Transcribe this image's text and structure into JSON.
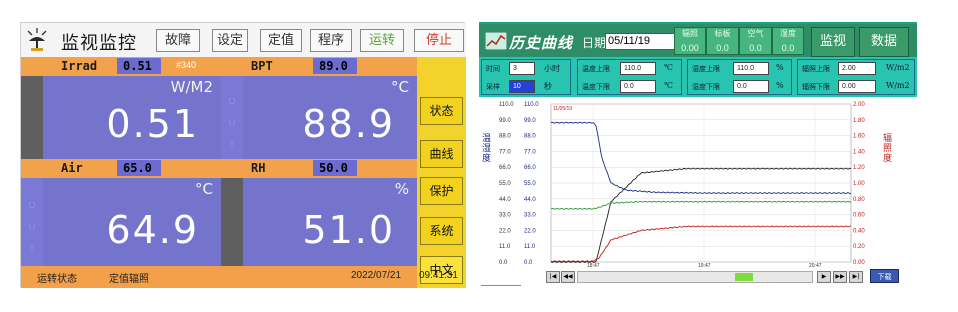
{
  "left_panel": {
    "title": "监视监控",
    "menu": [
      "故障",
      "设定",
      "定值",
      "程序",
      "运转",
      "停止"
    ],
    "sensors": {
      "irrad": {
        "label": "Irrad",
        "setpoint": "0.51",
        "tag": "#340",
        "unit": "W/M2",
        "value": "0.51"
      },
      "bpt": {
        "label": "BPT",
        "setpoint": "89.0",
        "unit": "°C",
        "value": "88.9"
      },
      "air": {
        "label": "Air",
        "setpoint": "65.0",
        "unit": "°C",
        "value": "64.9"
      },
      "rh": {
        "label": "RH",
        "setpoint": "50.0",
        "unit": "%",
        "value": "51.0"
      }
    },
    "out_label": "OUT",
    "side_buttons": [
      "状态",
      "曲线",
      "保护",
      "系统",
      "中文"
    ],
    "status": {
      "label": "运转状态",
      "mode": "定值辐照",
      "date": "2022/07/21",
      "time": "09:41:31"
    }
  },
  "right_panel": {
    "title": "历史曲线",
    "date_label": "日期",
    "date_value": "05/11/19",
    "mini_readouts": [
      {
        "label": "辐照",
        "value": "0.00"
      },
      {
        "label": "标板",
        "value": "0.0"
      },
      {
        "label": "空气",
        "value": "0.0"
      },
      {
        "label": "湿度",
        "value": "0.0"
      }
    ],
    "buttons": {
      "monitor": "监视",
      "data": "数据"
    },
    "params": {
      "time_label": "时间",
      "time_value": "3",
      "time_unit": "小时",
      "sample_label": "采样",
      "sample_value": "10",
      "sample_unit": "秒",
      "temp_upper_label": "温度上限",
      "temp_upper_value": "110.0",
      "temp_lower_label": "温度下限",
      "temp_lower_value": "0.0",
      "temp_unit": "℃",
      "hum_upper_label": "湿度上限",
      "hum_upper_value": "110.0",
      "hum_lower_label": "湿度下限",
      "hum_lower_value": "0.0",
      "hum_unit": "%",
      "rad_upper_label": "辐照上限",
      "rad_upper_value": "2.00",
      "rad_lower_label": "辐照下限",
      "rad_lower_value": "0.00",
      "rad_unit": "W/m2"
    },
    "download_label": "下载",
    "colors": {
      "header": "#2e8c66",
      "params": "#28c4b0",
      "temp": "#1a2a8a",
      "rad": "#c0201a",
      "green": "#2a9a3a"
    }
  },
  "chart_data": {
    "type": "line",
    "ylabel_left": "温湿度",
    "ylabel_right": "辐照度",
    "ylim_left": [
      0.0,
      110.0
    ],
    "ylim_right": [
      0.0,
      2.0
    ],
    "y_ticks_left": [
      "110.0",
      "99.0",
      "88.0",
      "77.0",
      "66.0",
      "55.0",
      "44.0",
      "33.0",
      "22.0",
      "11.0",
      "0.0"
    ],
    "y_ticks_right": [
      "2.00",
      "1.80",
      "1.60",
      "1.40",
      "1.20",
      "1.00",
      "0.80",
      "0.60",
      "0.40",
      "0.20",
      "0.00"
    ],
    "top_label": "11/05/19",
    "x_ticks": [
      "18:47",
      "19:47",
      "20:47"
    ],
    "grid": true,
    "series": [
      {
        "color": "#1a2a8a",
        "axis": "left",
        "x": [
          0,
          0.14,
          0.15,
          0.17,
          0.2,
          0.25,
          0.35,
          0.5,
          0.7,
          1.0
        ],
        "y": [
          97,
          97,
          95,
          72,
          55,
          50,
          48.5,
          48,
          48,
          48
        ]
      },
      {
        "color": "#222222",
        "axis": "left",
        "x": [
          0,
          0.14,
          0.15,
          0.2,
          0.3,
          0.45,
          0.6,
          1.0
        ],
        "y": [
          0,
          0,
          0,
          42,
          62,
          65,
          65,
          65
        ]
      },
      {
        "color": "#2a9a3a",
        "axis": "left",
        "x": [
          0,
          0.14,
          0.16,
          0.2,
          0.3,
          0.45,
          0.7,
          1.0
        ],
        "y": [
          37,
          37,
          38,
          41,
          42,
          42,
          42,
          42
        ]
      },
      {
        "color": "#c0201a",
        "axis": "right",
        "x": [
          0,
          0.14,
          0.16,
          0.2,
          0.3,
          0.45,
          0.7,
          1.0
        ],
        "y": [
          0.01,
          0.01,
          0.05,
          0.28,
          0.4,
          0.45,
          0.45,
          0.45
        ]
      }
    ]
  }
}
